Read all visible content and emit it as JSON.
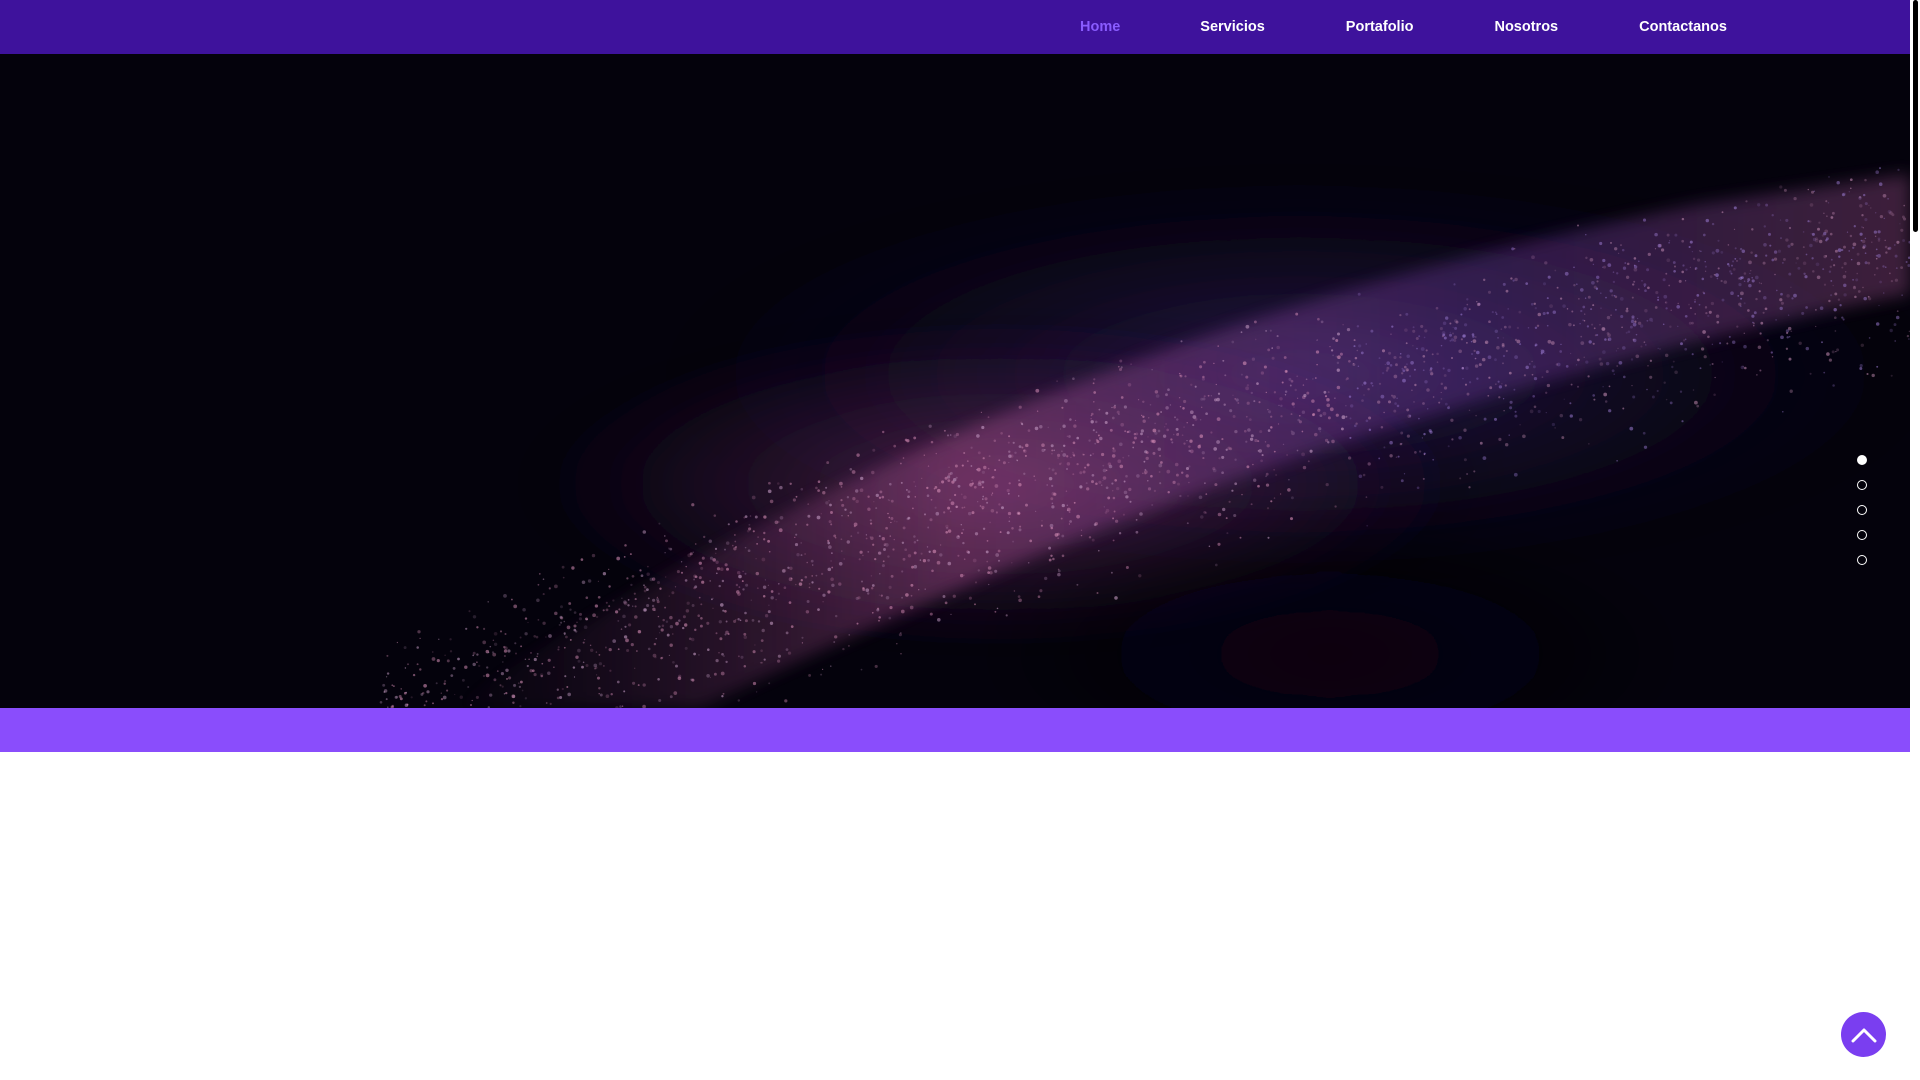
{
  "nav": {
    "items": [
      {
        "label": "Home",
        "active": true
      },
      {
        "label": "Servicios",
        "active": false
      },
      {
        "label": "Portafolio",
        "active": false
      },
      {
        "label": "Nosotros",
        "active": false
      },
      {
        "label": "Contactanos",
        "active": false
      }
    ]
  },
  "colors": {
    "nav_bar": "#3e129c",
    "nav_active": "#8a5cff",
    "nav_text": "#ffffff",
    "hero_background": "#04020c",
    "purple_band": "#8a4dfc",
    "back_to_top": "#7a3ef0"
  },
  "section_dots": {
    "count": 5,
    "active_index": 0
  },
  "back_to_top": {
    "icon": "chevron-up-icon"
  }
}
